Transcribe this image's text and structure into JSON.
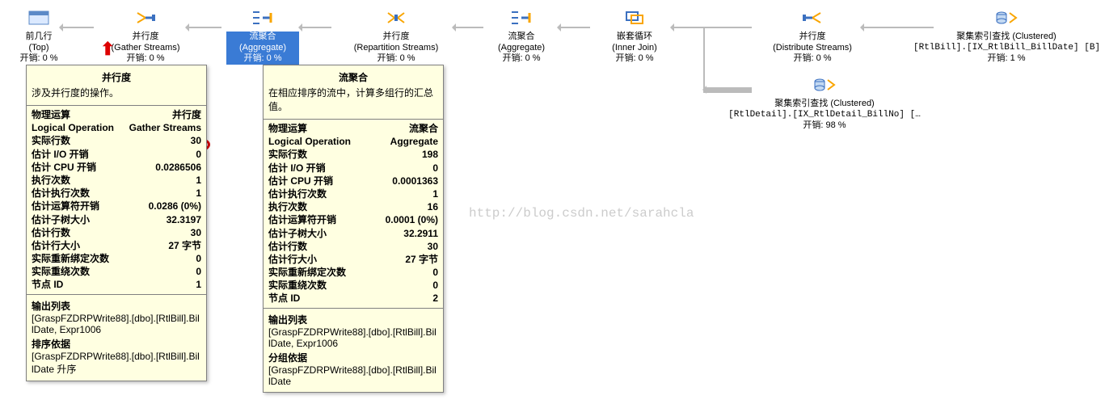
{
  "nodes": {
    "n0": {
      "main": "前几行",
      "sub": "(Top)",
      "cost": "开销: 0 %"
    },
    "n1": {
      "main": "并行度",
      "sub": "(Gather Streams)",
      "cost": "开销: 0 %"
    },
    "n2": {
      "main": "流聚合",
      "sub": "(Aggregate)",
      "cost": "开销: 0 %"
    },
    "n3": {
      "main": "并行度",
      "sub": "(Repartition Streams)",
      "cost": "开销: 0 %"
    },
    "n4": {
      "main": "流聚合",
      "sub": "(Aggregate)",
      "cost": "开销: 0 %"
    },
    "n5": {
      "main": "嵌套循环",
      "sub": "(Inner Join)",
      "cost": "开销: 0 %"
    },
    "n6": {
      "main": "并行度",
      "sub": "(Distribute Streams)",
      "cost": "开销: 0 %"
    },
    "n7": {
      "main": "聚集索引查找 (Clustered)",
      "sub": "[RtlBill].[IX_RtlBill_BillDate] [B]",
      "cost": "开销: 1 %"
    },
    "n8": {
      "main": "聚集索引查找 (Clustered)",
      "sub": "[RtlDetail].[IX_RtlDetail_BillNo] […",
      "cost": "开销: 98 %"
    }
  },
  "tooltip1": {
    "title": "并行度",
    "desc": "涉及并行度的操作。",
    "rows": [
      {
        "k": "物理运算",
        "v": "并行度",
        "b": true
      },
      {
        "k": "Logical Operation",
        "v": "Gather Streams",
        "b": true
      },
      {
        "k": "实际行数",
        "v": "30",
        "b": true,
        "circle": true
      },
      {
        "k": "估计 I/O 开销",
        "v": "0",
        "b": true
      },
      {
        "k": "估计 CPU 开销",
        "v": "0.0286506",
        "b": true
      },
      {
        "k": "执行次数",
        "v": "1",
        "b": true
      },
      {
        "k": "估计执行次数",
        "v": "1",
        "b": true
      },
      {
        "k": "估计运算符开销",
        "v": "0.0286 (0%)",
        "b": true
      },
      {
        "k": "估计子树大小",
        "v": "32.3197",
        "b": true
      },
      {
        "k": "估计行数",
        "v": "30",
        "b": true
      },
      {
        "k": "估计行大小",
        "v": "27 字节",
        "b": true
      },
      {
        "k": "实际重新绑定次数",
        "v": "0",
        "b": true
      },
      {
        "k": "实际重绕次数",
        "v": "0",
        "b": true
      },
      {
        "k": "节点 ID",
        "v": "1",
        "b": true
      }
    ],
    "outListLabel": "输出列表",
    "outList": "[GraspFZDRPWrite88].[dbo].[RtlBill].BillDate, Expr1006",
    "orderLabel": "排序依据",
    "order": "[GraspFZDRPWrite88].[dbo].[RtlBill].BillDate 升序"
  },
  "tooltip2": {
    "title": "流聚合",
    "desc": "在相应排序的流中，计算多组行的汇总值。",
    "rows": [
      {
        "k": "物理运算",
        "v": "流聚合",
        "b": true
      },
      {
        "k": "Logical Operation",
        "v": "Aggregate",
        "b": true,
        "circle": true
      },
      {
        "k": "实际行数",
        "v": "198",
        "b": true
      },
      {
        "k": "估计 I/O 开销",
        "v": "0",
        "b": true
      },
      {
        "k": "估计 CPU 开销",
        "v": "0.0001363",
        "b": true
      },
      {
        "k": "估计执行次数",
        "v": "1",
        "b": true
      },
      {
        "k": "执行次数",
        "v": "16",
        "b": true
      },
      {
        "k": "估计运算符开销",
        "v": "0.0001 (0%)",
        "b": true
      },
      {
        "k": "估计子树大小",
        "v": "32.2911",
        "b": true
      },
      {
        "k": "估计行数",
        "v": "30",
        "b": true
      },
      {
        "k": "估计行大小",
        "v": "27 字节",
        "b": true
      },
      {
        "k": "实际重新绑定次数",
        "v": "0",
        "b": true
      },
      {
        "k": "实际重绕次数",
        "v": "0",
        "b": true
      },
      {
        "k": "节点 ID",
        "v": "2",
        "b": true
      }
    ],
    "outListLabel": "输出列表",
    "outList": "[GraspFZDRPWrite88].[dbo].[RtlBill].BillDate, Expr1006",
    "groupLabel": "分组依据",
    "group": "[GraspFZDRPWrite88].[dbo].[RtlBill].BillDate"
  },
  "watermark": "http://blog.csdn.net/sarahcla"
}
